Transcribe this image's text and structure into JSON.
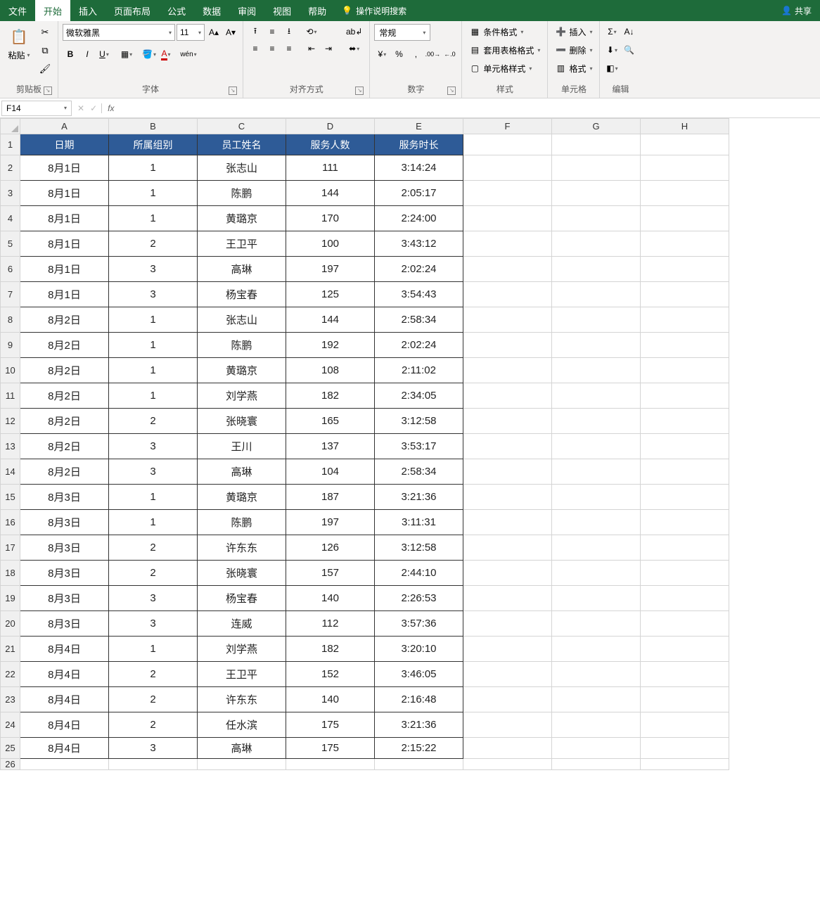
{
  "tabs": {
    "file": "文件",
    "home": "开始",
    "insert": "插入",
    "layout": "页面布局",
    "formulas": "公式",
    "data": "数据",
    "review": "审阅",
    "view": "视图",
    "help": "帮助",
    "tellme": "操作说明搜索",
    "share": "共享"
  },
  "ribbon": {
    "clipboard": {
      "paste": "粘贴",
      "group": "剪贴板"
    },
    "font": {
      "name": "微软雅黑",
      "size": "11",
      "group": "字体"
    },
    "alignment": {
      "group": "对齐方式"
    },
    "number": {
      "format": "常规",
      "group": "数字"
    },
    "styles": {
      "cond": "条件格式",
      "table": "套用表格格式",
      "cell": "单元格样式",
      "group": "样式"
    },
    "cells": {
      "insert": "插入",
      "delete": "删除",
      "format": "格式",
      "group": "单元格"
    },
    "editing": {
      "group": "编辑"
    }
  },
  "namebox": "F14",
  "columns": [
    "A",
    "B",
    "C",
    "D",
    "E",
    "F",
    "G",
    "H"
  ],
  "headers": [
    "日期",
    "所属组别",
    "员工姓名",
    "服务人数",
    "服务时长"
  ],
  "rows": [
    [
      "8月1日",
      "1",
      "张志山",
      "111",
      "3:14:24"
    ],
    [
      "8月1日",
      "1",
      "陈鹏",
      "144",
      "2:05:17"
    ],
    [
      "8月1日",
      "1",
      "黄璐京",
      "170",
      "2:24:00"
    ],
    [
      "8月1日",
      "2",
      "王卫平",
      "100",
      "3:43:12"
    ],
    [
      "8月1日",
      "3",
      "高琳",
      "197",
      "2:02:24"
    ],
    [
      "8月1日",
      "3",
      "杨宝春",
      "125",
      "3:54:43"
    ],
    [
      "8月2日",
      "1",
      "张志山",
      "144",
      "2:58:34"
    ],
    [
      "8月2日",
      "1",
      "陈鹏",
      "192",
      "2:02:24"
    ],
    [
      "8月2日",
      "1",
      "黄璐京",
      "108",
      "2:11:02"
    ],
    [
      "8月2日",
      "1",
      "刘学燕",
      "182",
      "2:34:05"
    ],
    [
      "8月2日",
      "2",
      "张晓寰",
      "165",
      "3:12:58"
    ],
    [
      "8月2日",
      "3",
      "王川",
      "137",
      "3:53:17"
    ],
    [
      "8月2日",
      "3",
      "高琳",
      "104",
      "2:58:34"
    ],
    [
      "8月3日",
      "1",
      "黄璐京",
      "187",
      "3:21:36"
    ],
    [
      "8月3日",
      "1",
      "陈鹏",
      "197",
      "3:11:31"
    ],
    [
      "8月3日",
      "2",
      "许东东",
      "126",
      "3:12:58"
    ],
    [
      "8月3日",
      "2",
      "张晓寰",
      "157",
      "2:44:10"
    ],
    [
      "8月3日",
      "3",
      "杨宝春",
      "140",
      "2:26:53"
    ],
    [
      "8月3日",
      "3",
      "连威",
      "112",
      "3:57:36"
    ],
    [
      "8月4日",
      "1",
      "刘学燕",
      "182",
      "3:20:10"
    ],
    [
      "8月4日",
      "2",
      "王卫平",
      "152",
      "3:46:05"
    ],
    [
      "8月4日",
      "2",
      "许东东",
      "140",
      "2:16:48"
    ],
    [
      "8月4日",
      "2",
      "任水滨",
      "175",
      "3:21:36"
    ],
    [
      "8月4日",
      "3",
      "高琳",
      "175",
      "2:15:22"
    ]
  ]
}
